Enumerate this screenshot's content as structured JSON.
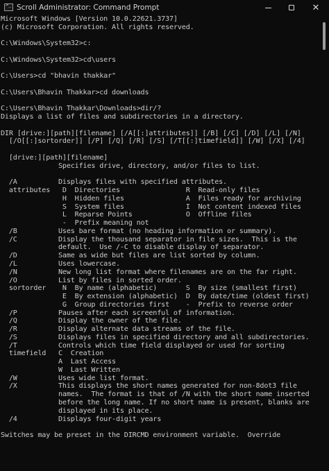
{
  "window": {
    "title": "Scroll Administrator: Command Prompt",
    "buttons": {
      "minimize": "minimize",
      "maximize": "maximize",
      "close": "✕"
    }
  },
  "console": {
    "lines": [
      "Microsoft Windows [Version 10.0.22621.3737]",
      "(c) Microsoft Corporation. All rights reserved.",
      "",
      "C:\\Windows\\System32>c:",
      "",
      "C:\\Windows\\System32>cd\\users",
      "",
      "C:\\Users>cd \"bhavin thakkar\"",
      "",
      "C:\\Users\\Bhavin Thakkar>cd downloads",
      "",
      "C:\\Users\\Bhavin Thakkar\\Downloads>dir/?",
      "Displays a list of files and subdirectories in a directory.",
      "",
      "DIR [drive:][path][filename] [/A[[:]attributes]] [/B] [/C] [/D] [/L] [/N]",
      "  [/O[[:]sortorder]] [/P] [/Q] [/R] [/S] [/T[[:]timefield]] [/W] [/X] [/4]",
      "",
      "  [drive:][path][filename]",
      "              Specifies drive, directory, and/or files to list.",
      "",
      "  /A          Displays files with specified attributes.",
      "  attributes   D  Directories                R  Read-only files",
      "               H  Hidden files               A  Files ready for archiving",
      "               S  System files               I  Not content indexed files",
      "               L  Reparse Points             O  Offline files",
      "               -  Prefix meaning not",
      "  /B          Uses bare format (no heading information or summary).",
      "  /C          Display the thousand separator in file sizes.  This is the",
      "              default.  Use /-C to disable display of separator.",
      "  /D          Same as wide but files are list sorted by column.",
      "  /L          Uses lowercase.",
      "  /N          New long list format where filenames are on the far right.",
      "  /O          List by files in sorted order.",
      "  sortorder    N  By name (alphabetic)       S  By size (smallest first)",
      "               E  By extension (alphabetic)  D  By date/time (oldest first)",
      "               G  Group directories first    -  Prefix to reverse order",
      "  /P          Pauses after each screenful of information.",
      "  /Q          Display the owner of the file.",
      "  /R          Display alternate data streams of the file.",
      "  /S          Displays files in specified directory and all subdirectories.",
      "  /T          Controls which time field displayed or used for sorting",
      "  timefield   C  Creation",
      "              A  Last Access",
      "              W  Last Written",
      "  /W          Uses wide list format.",
      "  /X          This displays the short names generated for non-8dot3 file",
      "              names.  The format is that of /N with the short name inserted",
      "              before the long name. If no short name is present, blanks are",
      "              displayed in its place.",
      "  /4          Displays four-digit years",
      "",
      "Switches may be preset in the DIRCMD environment variable.  Override"
    ]
  },
  "colors": {
    "background": "#0c0c0c",
    "text": "#cccccc",
    "scroll_thumb": "#9b9b9b"
  },
  "icons": [
    "cmd-app-icon",
    "minimize-icon",
    "maximize-icon",
    "close-icon"
  ]
}
